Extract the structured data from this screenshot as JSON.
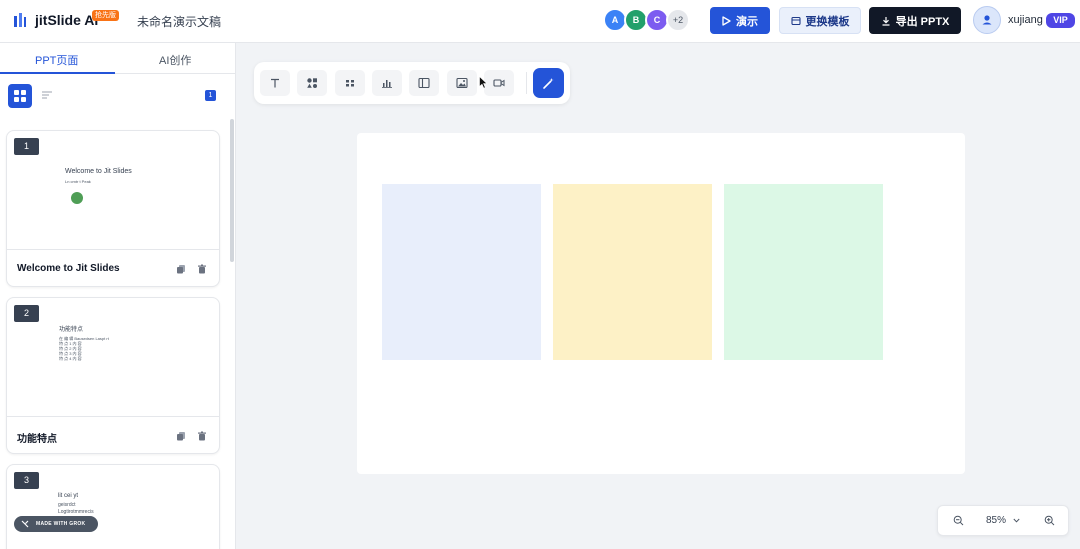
{
  "header": {
    "app_name": "jitSlide AI",
    "beta_badge": "抢先版",
    "doc_title": "未命名演示文稿",
    "collaborators": [
      "A",
      "B",
      "C"
    ],
    "collaborators_more": "+2",
    "present_label": "演示",
    "template_label": "更换模板",
    "export_label": "导出 PPTX",
    "user_name": "xujiang",
    "vip_label": "VIP"
  },
  "colors": {
    "primary": "#2454d8",
    "avatar_a": "#3b82f6",
    "avatar_b": "#22a06b",
    "avatar_c": "#7c5cf0",
    "dark": "#111827"
  },
  "sidebar": {
    "tabs": [
      {
        "label": "PPT页面",
        "active": true
      },
      {
        "label": "AI创作",
        "active": false
      }
    ],
    "page_count": "1",
    "slides": [
      {
        "number": "1",
        "title": "Welcome to Jit Slides",
        "thumb_heading": "Welcome to Jit Slides",
        "thumb_sub": "Ln cmtr t Peak"
      },
      {
        "number": "2",
        "title": "功能特点",
        "thumb_heading": "功能特点",
        "thumb_sub": "在 编 辑 Bausedsen Laspt rt\n特 点 1 内 容\n特 点 2 内 容\n特 点 3 内 容\n特 点 4 内 容"
      },
      {
        "number": "3",
        "title": "",
        "thumb_heading": "lit cei yt",
        "thumb_sub": "geisrdct\nLogtirotmmrecis"
      }
    ],
    "grok_badge": "MADE WITH GROK"
  },
  "toolbar": {
    "tools": [
      "text-icon",
      "shapes-icon",
      "components-icon",
      "chart-icon",
      "layout-icon",
      "image-icon",
      "video-icon"
    ],
    "magic": "magic-wand-icon"
  },
  "canvas": {
    "boxes": [
      {
        "color": "#e8eefb"
      },
      {
        "color": "#fdf1c6"
      },
      {
        "color": "#dcf8e6"
      }
    ]
  },
  "zoom": {
    "level": "85%"
  }
}
